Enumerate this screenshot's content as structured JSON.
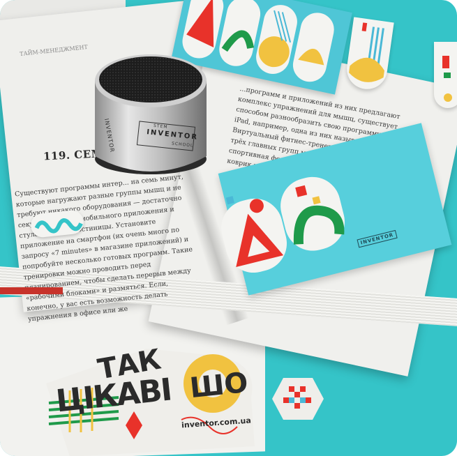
{
  "photo": {
    "subject": "Open book with INVENTOR branded speaker, bookmarks, sticky notes and stickers on turquoise table",
    "colors": {
      "table": "#35c4c8",
      "paper": "#eeeeec",
      "accent_red": "#e8322a",
      "accent_yellow": "#f1c240",
      "accent_green": "#1f9a4a",
      "accent_blue": "#4ab8d6"
    }
  },
  "book": {
    "left_page": {
      "running_head": "ТАЙМ-МЕНЕДЖМЕНТ",
      "heading": "119. СЕМЬ МИ",
      "paragraph": "Существуют программы интер... на семь минут, которые нагружают разные группы мышц и не требуют никакого оборудования — достаточно секундомера или мобильного приложения и стула в номере гостиницы. Установите приложение на смартфон (их очень много по запросу «7 minutes» в магазине приложений) и попробуйте несколько готовых программ. Такие тренировки можно проводить перед планированием, чтобы сделать перерыв между «рабочими блоками» и размяться. Если, конечно, у вас есть возможность делать упражнения в офисе или же"
    },
    "right_page": {
      "paragraph": "...программ и приложений из них предлагают комплекс упражнений для мышц, существует способом разнообразить свою программу на iPad, например, одна из них называется ABS. Виртуальный фитнес-тренер и иногда... кроме трёх главных групп мышц ... Если у вас спортивная форма, коврик ... поставьте на коврик рядом ..."
    }
  },
  "speaker": {
    "brand": "INVENTOR",
    "label_top": "STEM",
    "label_bottom": "SCHOOL"
  },
  "sticky_note": {
    "brand": "INVENTOR"
  },
  "sticker": {
    "line1": "ТАК",
    "line2": "ЦІКАВІ",
    "line3": "ШО",
    "url": "inventor.com.ua"
  }
}
